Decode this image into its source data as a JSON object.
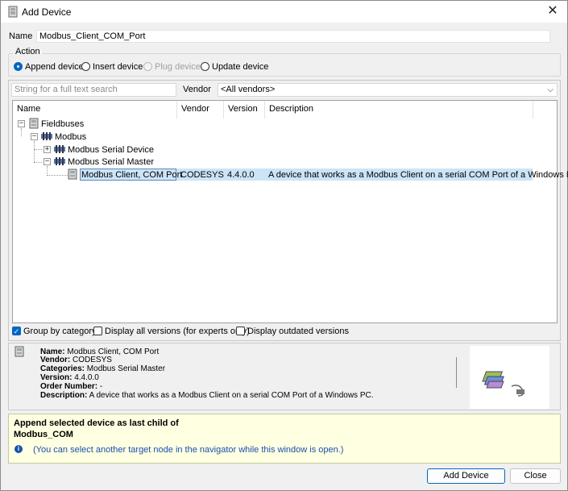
{
  "window": {
    "title": "Add Device",
    "close_glyph": "✕"
  },
  "name_row": {
    "label": "Name",
    "value": "Modbus_Client_COM_Port"
  },
  "action": {
    "legend": "Action",
    "options": [
      {
        "label": "Append device",
        "checked": true,
        "disabled": false
      },
      {
        "label": "Insert device",
        "checked": false,
        "disabled": false
      },
      {
        "label": "Plug device",
        "checked": false,
        "disabled": true
      },
      {
        "label": "Update device",
        "checked": false,
        "disabled": false
      }
    ]
  },
  "search": {
    "placeholder": "String for a full text search"
  },
  "vendor": {
    "label": "Vendor",
    "selected": "<All vendors>"
  },
  "tree": {
    "columns": [
      "Name",
      "Vendor",
      "Version",
      "Description"
    ],
    "fieldbuses": "Fieldbuses",
    "modbus": "Modbus",
    "serial_device": "Modbus Serial Device",
    "serial_master": "Modbus Serial Master",
    "selected": {
      "name": "Modbus Client, COM Port",
      "vendor": "CODESYS",
      "version": "4.4.0.0",
      "description": "A device that works as a Modbus Client on a serial COM Port of a Windows PC."
    }
  },
  "options": {
    "group_by_category": "Group by category",
    "display_all_versions": "Display all versions (for experts only)",
    "display_outdated": "Display outdated versions"
  },
  "info": {
    "name_label": "Name:",
    "name": "Modbus Client, COM Port",
    "vendor_label": "Vendor:",
    "vendor": "CODESYS",
    "categories_label": "Categories:",
    "categories": "Modbus Serial Master",
    "version_label": "Version:",
    "version": "4.4.0.0",
    "order_label": "Order Number:",
    "order": "-",
    "description_label": "Description:",
    "description": "A device that works as a Modbus Client on a serial COM Port of a Windows PC."
  },
  "note": {
    "line1": "Append selected device as last child of",
    "line2": "Modbus_COM",
    "hint": "(You can select another target node in the navigator while this window is open.)",
    "hint_icon": "i"
  },
  "buttons": {
    "add": "Add Device",
    "close": "Close"
  },
  "colors": {
    "accent": "#0067c0",
    "selection": "#cce4f7",
    "note_bg": "#ffffe1"
  }
}
